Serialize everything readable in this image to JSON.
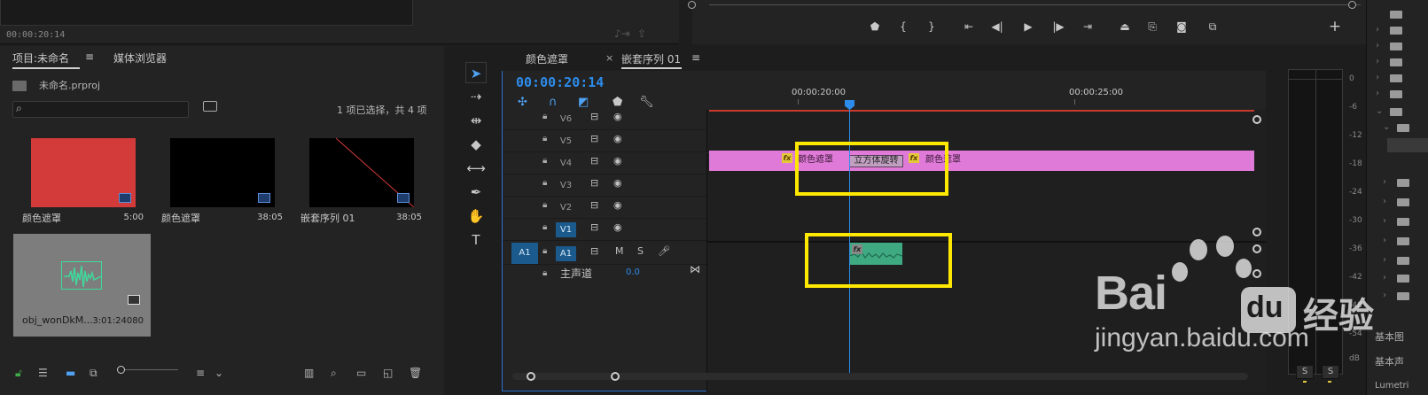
{
  "source_monitor": {
    "timecode": "00:00:20:14"
  },
  "program_monitor": {
    "transport_icons": [
      "marker-icon",
      "in-point-icon",
      "out-point-icon",
      "go-to-in-icon",
      "step-back-icon",
      "play-icon",
      "step-forward-icon",
      "go-to-out-icon",
      "lift-icon",
      "extract-icon",
      "export-frame-icon",
      "compare-icon"
    ],
    "add_button": "+"
  },
  "project_panel": {
    "tab_project": "项目:未命名",
    "tab_media_browser": "媒体浏览器",
    "project_file": "未命名.prproj",
    "selection_info": "1 项已选择，共 4 项",
    "items": [
      {
        "name": "颜色遮罩",
        "duration": "5:00",
        "color": "#d33a3a"
      },
      {
        "name": "颜色遮罩",
        "duration": "38:05",
        "color": "#000000"
      },
      {
        "name": "嵌套序列 01",
        "duration": "38:05",
        "color": "#000000"
      },
      {
        "name": "obj_wonDkM...",
        "duration": "3:01:24080",
        "color": "#7d7d7d"
      }
    ]
  },
  "sequence": {
    "tab_color_matte": "颜色遮罩",
    "tab_nested": "嵌套序列 01",
    "close_label": "×",
    "menu_label": "≡",
    "timecode": "00:00:20:14",
    "ruler_labels": [
      "00:00:20:00",
      "00:00:25:00"
    ],
    "video_tracks": [
      "V6",
      "V5",
      "V4",
      "V3",
      "V2",
      "V1"
    ],
    "audio_track": "A1",
    "audio_source": "A1",
    "audio_m": "M",
    "audio_s": "S",
    "master_label": "主声道",
    "master_value": "0.0",
    "clip_left_label": "颜色遮罩",
    "clip_right_label": "颜色遮罩",
    "transition_label": "立方体旋转",
    "fx_label": "fx"
  },
  "meter": {
    "db_scale": [
      "0",
      "-6",
      "-12",
      "-18",
      "-24",
      "-30",
      "-36",
      "-42",
      "-48",
      "-54",
      "dB"
    ],
    "solo_label": "S"
  },
  "right_panel": {
    "labels": [
      "基本图",
      "基本声",
      "Lumetri"
    ]
  },
  "watermark": {
    "brand": "Bai",
    "brand_du": "du",
    "cn": "经验",
    "url": "jingyan.baidu.com"
  }
}
